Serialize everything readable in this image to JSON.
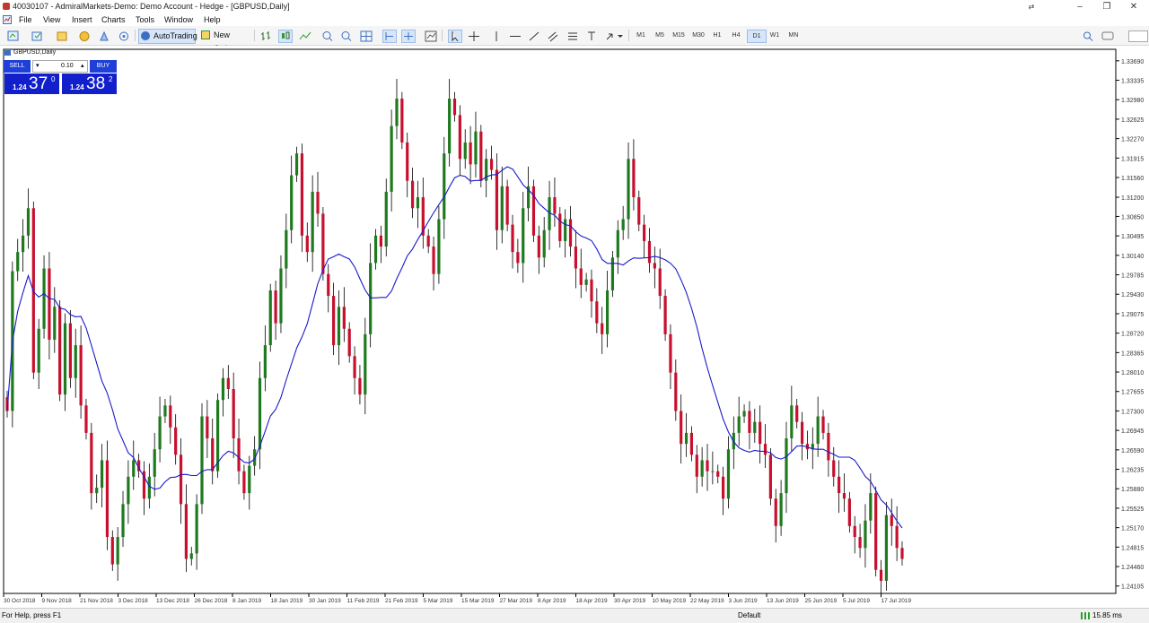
{
  "window": {
    "title": "40030107 - AdmiralMarkets-Demo: Demo Account - Hedge - [GBPUSD,Daily]"
  },
  "menu": [
    "File",
    "View",
    "Insert",
    "Charts",
    "Tools",
    "Window",
    "Help"
  ],
  "toolbar": {
    "autotrading": "AutoTrading",
    "new_order": "New Order",
    "timeframes": [
      "M1",
      "M5",
      "M15",
      "M30",
      "H1",
      "H4",
      "D1",
      "W1",
      "MN"
    ],
    "active_timeframe": "D1"
  },
  "trade_panel": {
    "symbol": "GBPUSD,Daily",
    "sell": "SELL",
    "buy": "BUY",
    "lots": "0.10",
    "bid_small": "1.24",
    "bid_big": "37",
    "bid_sup": "0",
    "ask_small": "1.24",
    "ask_big": "38",
    "ask_sup": "2"
  },
  "status": {
    "help": "For Help, press F1",
    "profile": "Default",
    "traffic": "15.85 ms"
  },
  "colors": {
    "bull": "#1f7a1f",
    "bear": "#c8102e",
    "ma": "#1a1acc",
    "grid": "#e6e6e6"
  },
  "chart_data": {
    "type": "candlestick",
    "y_ticks": [
      "1.33690",
      "1.33335",
      "1.32980",
      "1.32625",
      "1.32270",
      "1.31915",
      "1.31560",
      "1.31200",
      "1.30850",
      "1.30495",
      "1.30140",
      "1.29785",
      "1.29430",
      "1.29075",
      "1.28720",
      "1.28365",
      "1.28010",
      "1.27655",
      "1.27300",
      "1.26945",
      "1.26590",
      "1.26235",
      "1.25880",
      "1.25525",
      "1.25170",
      "1.24815",
      "1.24460",
      "1.24105"
    ],
    "y_range": [
      1.2397,
      1.339
    ],
    "x_labels": [
      "30 Oct 2018",
      "9 Nov 2018",
      "21 Nov 2018",
      "3 Dec 2018",
      "13 Dec 2018",
      "26 Dec 2018",
      "8 Jan 2019",
      "18 Jan 2019",
      "30 Jan 2019",
      "11 Feb 2019",
      "21 Feb 2019",
      "5 Mar 2019",
      "15 Mar 2019",
      "27 Mar 2019",
      "8 Apr 2019",
      "18 Apr 2019",
      "30 Apr 2019",
      "10 May 2019",
      "22 May 2019",
      "3 Jun 2019",
      "13 Jun 2019",
      "25 Jun 2019",
      "5 Jul 2019",
      "17 Jul 2019"
    ],
    "closes": [
      1.273,
      1.2985,
      1.302,
      1.305,
      1.31,
      1.28,
      1.288,
      1.299,
      1.286,
      1.292,
      1.276,
      1.289,
      1.279,
      1.285,
      1.274,
      1.269,
      1.258,
      1.259,
      1.264,
      1.25,
      1.245,
      1.25,
      1.256,
      1.261,
      1.264,
      1.262,
      1.257,
      1.261,
      1.266,
      1.272,
      1.274,
      1.27,
      1.265,
      1.256,
      1.246,
      1.247,
      1.256,
      1.272,
      1.268,
      1.262,
      1.275,
      1.279,
      1.277,
      1.268,
      1.262,
      1.258,
      1.263,
      1.266,
      1.279,
      1.285,
      1.295,
      1.289,
      1.299,
      1.306,
      1.316,
      1.32,
      1.305,
      1.302,
      1.313,
      1.309,
      1.298,
      1.294,
      1.285,
      1.292,
      1.288,
      1.283,
      1.279,
      1.276,
      1.287,
      1.3,
      1.305,
      1.303,
      1.313,
      1.325,
      1.33,
      1.322,
      1.315,
      1.31,
      1.312,
      1.305,
      1.303,
      1.298,
      1.308,
      1.32,
      1.33,
      1.327,
      1.319,
      1.322,
      1.318,
      1.324,
      1.315,
      1.319,
      1.317,
      1.306,
      1.314,
      1.307,
      1.302,
      1.3,
      1.31,
      1.314,
      1.305,
      1.301,
      1.306,
      1.312,
      1.309,
      1.304,
      1.308,
      1.303,
      1.299,
      1.296,
      1.297,
      1.293,
      1.289,
      1.287,
      1.295,
      1.301,
      1.306,
      1.308,
      1.319,
      1.312,
      1.307,
      1.304,
      1.3,
      1.299,
      1.294,
      1.287,
      1.28,
      1.273,
      1.267,
      1.269,
      1.265,
      1.261,
      1.264,
      1.262,
      1.262,
      1.261,
      1.257,
      1.266,
      1.269,
      1.272,
      1.273,
      1.269,
      1.271,
      1.267,
      1.265,
      1.257,
      1.252,
      1.258,
      1.268,
      1.274,
      1.271,
      1.267,
      1.266,
      1.267,
      1.272,
      1.269,
      1.264,
      1.261,
      1.258,
      1.257,
      1.252,
      1.25,
      1.248,
      1.253,
      1.258,
      1.244,
      1.242,
      1.254,
      1.252,
      1.248,
      1.246
    ],
    "ma_period": 14
  }
}
